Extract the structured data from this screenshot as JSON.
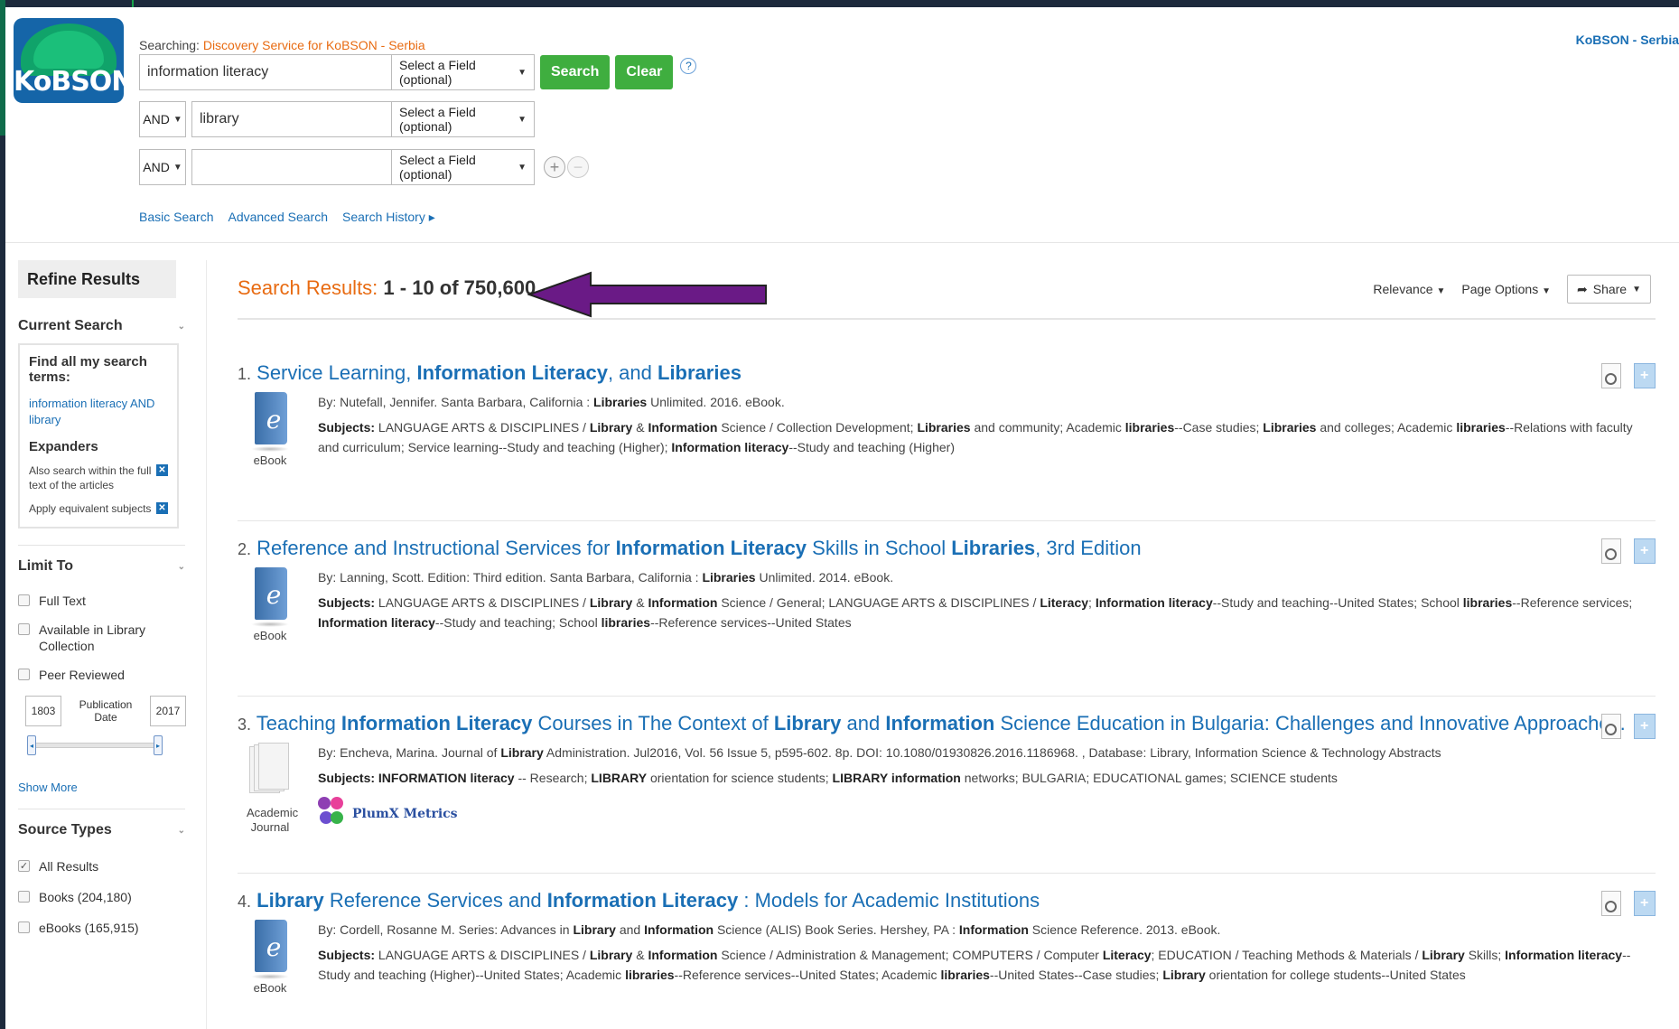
{
  "header": {
    "logo_text": "KoBSON",
    "searching_label": "Searching:",
    "searching_service": "Discovery Service for KoBSON - Serbia",
    "top_right_link": "KoBSON - Serbia",
    "rows": [
      {
        "value": "information literacy",
        "field": "Select a Field (optional)"
      },
      {
        "bool": "AND",
        "value": "library",
        "field": "Select a Field (optional)"
      },
      {
        "bool": "AND",
        "value": "",
        "field": "Select a Field (optional)"
      }
    ],
    "search_button": "Search",
    "clear_button": "Clear",
    "help": "?",
    "add": "+",
    "remove": "−",
    "links": [
      "Basic Search",
      "Advanced Search",
      "Search History ▸"
    ]
  },
  "sidebar": {
    "refine_title": "Refine Results",
    "current_search": {
      "title": "Current Search",
      "find_all": "Find all my search terms:",
      "terms": "information literacy AND library",
      "expanders_title": "Expanders",
      "expanders": [
        "Also search within the full text of the articles",
        "Apply equivalent subjects"
      ]
    },
    "limit_to": {
      "title": "Limit To",
      "options": [
        "Full Text",
        "Available in Library Collection",
        "Peer Reviewed"
      ],
      "pub_date_label": "Publication Date",
      "date_from": "1803",
      "date_to": "2017",
      "show_more": "Show More"
    },
    "source_types": {
      "title": "Source Types",
      "options": [
        {
          "label": "All Results",
          "checked": true
        },
        {
          "label": "Books (204,180)",
          "checked": false
        },
        {
          "label": "eBooks (165,915)",
          "checked": false
        }
      ]
    }
  },
  "results": {
    "title_label": "Search Results:",
    "title_count": "1 - 10 of 750,600",
    "relevance": "Relevance",
    "page_options": "Page Options",
    "share": "Share",
    "items": [
      {
        "num": "1.",
        "title_html": "Service Learning, <b>Information Literacy</b>, and <b>Libraries</b>",
        "type": "eBook",
        "byline_html": "By: Nutefall, Jennifer. Santa Barbara, California : <b>Libraries</b> Unlimited. 2016. eBook.",
        "subjects_html": "<b>Subjects:</b> LANGUAGE ARTS &amp; DISCIPLINES / <b>Library</b> &amp; <b>Information</b> Science / Collection Development; <b>Libraries</b> and community; Academic <b>libraries</b>--Case studies; <b>Libraries</b> and colleges; Academic <b>libraries</b>--Relations with faculty and curriculum; Service learning--Study and teaching (Higher); <b>Information literacy</b>--Study and teaching (Higher)"
      },
      {
        "num": "2.",
        "title_html": "Reference and Instructional Services for <b>Information Literacy</b> Skills in School <b>Libraries</b>, 3rd Edition",
        "type": "eBook",
        "byline_html": "By: Lanning, Scott. Edition: Third edition. Santa Barbara, California : <b>Libraries</b> Unlimited. 2014. eBook.",
        "subjects_html": "<b>Subjects:</b> LANGUAGE ARTS &amp; DISCIPLINES / <b>Library</b> &amp; <b>Information</b> Science / General; LANGUAGE ARTS &amp; DISCIPLINES / <b>Literacy</b>; <b>Information literacy</b>--Study and teaching--United States; School <b>libraries</b>--Reference services; <b>Information literacy</b>--Study and teaching; School <b>libraries</b>--Reference services--United States"
      },
      {
        "num": "3.",
        "title_html": "Teaching <b>Information Literacy</b> Courses in The Context of <b>Library</b> and <b>Information</b> Science Education in Bulgaria: Challenges and Innovative Approaches.",
        "type": "Academic Journal",
        "byline_html": "By: Encheva, Marina. Journal of <b>Library</b> Administration. Jul2016, Vol. 56 Issue 5, p595-602. 8p. DOI: 10.1080/01930826.2016.1186968. , Database: Library, Information Science &amp; Technology Abstracts",
        "subjects_html": "<b>Subjects:</b> <b>INFORMATION literacy</b> -- Research; <b>LIBRARY</b> orientation for science students; <b>LIBRARY information</b> networks; BULGARIA; EDUCATIONAL games; SCIENCE students",
        "plumx": "PlumX Metrics"
      },
      {
        "num": "4.",
        "title_html": "<b>Library</b> Reference Services and <b>Information Literacy</b> : Models for Academic Institutions",
        "type": "eBook",
        "byline_html": "By: Cordell, Rosanne M. Series: Advances in <b>Library</b> and <b>Information</b> Science (ALIS) Book Series. Hershey, PA : <b>Information</b> Science Reference. 2013. eBook.",
        "subjects_html": "<b>Subjects:</b> LANGUAGE ARTS &amp; DISCIPLINES / <b>Library</b> &amp; <b>Information</b> Science / Administration &amp; Management; COMPUTERS / Computer <b>Literacy</b>; EDUCATION / Teaching Methods &amp; Materials / <b>Library</b> Skills; <b>Information literacy</b>--Study and teaching (Higher)--United States; Academic <b>libraries</b>--Reference services--United States; Academic <b>libraries</b>--United States--Case studies; <b>Library</b> orientation for college students--United States"
      }
    ]
  },
  "colors": {
    "link": "#1a6fb5",
    "accent_orange": "#e86b12",
    "button_green": "#3fae3f",
    "arrow": "#6a1a86"
  }
}
